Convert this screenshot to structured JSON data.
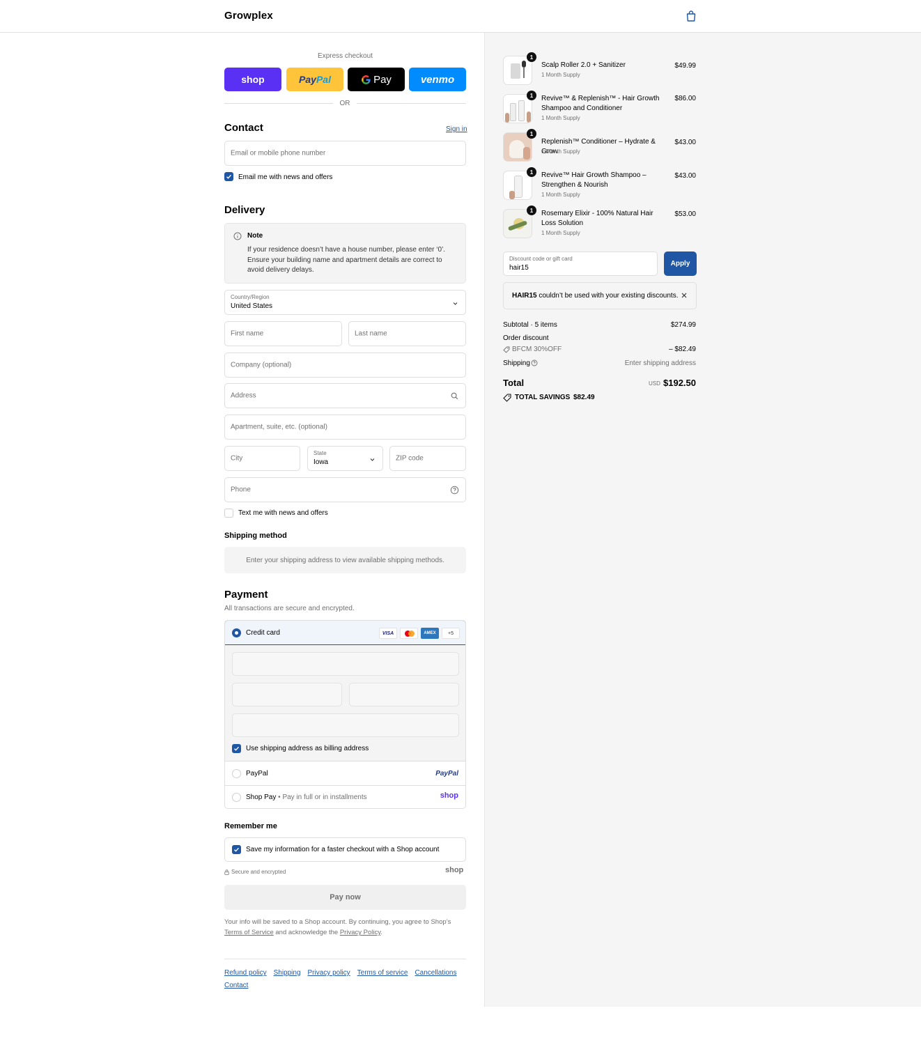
{
  "header": {
    "brand": "Growplex",
    "cart_icon": "shopping-bag-icon"
  },
  "express": {
    "title": "Express checkout",
    "buttons": [
      {
        "name": "shop",
        "label": "shop",
        "color": "#5a31f4"
      },
      {
        "name": "paypal",
        "label_a": "Pay",
        "label_b": "Pal",
        "color": "#ffc439"
      },
      {
        "name": "gpay",
        "label": "Pay",
        "color": "#000000"
      },
      {
        "name": "venmo",
        "label": "venmo",
        "color": "#008cff"
      }
    ],
    "or": "OR"
  },
  "contact": {
    "title": "Contact",
    "sign_in": "Sign in",
    "email_placeholder": "Email or mobile phone number",
    "email_news": "Email me with news and offers"
  },
  "delivery": {
    "title": "Delivery",
    "note_title": "Note",
    "note_text": "If your residence doesn’t have a house number, please enter ‘0’. Ensure your building name and apartment details are correct to avoid delivery delays.",
    "country_label": "Country/Region",
    "country_value": "United States",
    "first_name": "First name",
    "last_name": "Last name",
    "company": "Company (optional)",
    "address": "Address",
    "apartment": "Apartment, suite, etc. (optional)",
    "city": "City",
    "state_label": "State",
    "state_value": "Iowa",
    "zip": "ZIP code",
    "phone": "Phone",
    "text_news": "Text me with news and offers"
  },
  "shipping_method": {
    "title": "Shipping method",
    "placeholder": "Enter your shipping address to view available shipping methods."
  },
  "payment": {
    "title": "Payment",
    "subtitle": "All transactions are secure and encrypted.",
    "credit_card": "Credit card",
    "card_brands": [
      "VISA",
      "AMEX"
    ],
    "more_cards": "+5",
    "billing_same": "Use shipping address as billing address",
    "paypal": "PayPal",
    "paypal_logo": "PayPal",
    "shop_pay": "Shop Pay",
    "shop_pay_sub": "Pay in full or in installments",
    "shop_logo": "shop"
  },
  "remember": {
    "title": "Remember me",
    "save_info": "Save my information for a faster checkout with a Shop account",
    "secure": "Secure and encrypted",
    "shop_logo": "shop"
  },
  "pay_now": "Pay now",
  "legal": {
    "text_a": "Your info will be saved to a Shop account. By continuing, you agree to Shop’s",
    "tos": "Terms of Service",
    "text_b": "and acknowledge the",
    "privacy": "Privacy Policy",
    "text_c": "."
  },
  "footer_links": [
    "Refund policy",
    "Shipping",
    "Privacy policy",
    "Terms of service",
    "Cancellations",
    "Contact"
  ],
  "order": {
    "items": [
      {
        "qty": "1",
        "name": "Scalp Roller 2.0 + Sanitizer",
        "sub": "1 Month Supply",
        "price": "$49.99"
      },
      {
        "qty": "1",
        "name": "Revive™ & Replenish™ - Hair Growth Shampoo and Conditioner",
        "sub": "1 Month Supply",
        "price": "$86.00"
      },
      {
        "qty": "1",
        "name": "Replenish™ Conditioner – Hydrate & Grow",
        "sub": "1 Month Supply",
        "price": "$43.00"
      },
      {
        "qty": "1",
        "name": "Revive™ Hair Growth Shampoo – Strengthen & Nourish",
        "sub": "1 Month Supply",
        "price": "$43.00"
      },
      {
        "qty": "1",
        "name": "Rosemary Elixir - 100% Natural Hair Loss Solution",
        "sub": "1 Month Supply",
        "price": "$53.00"
      }
    ],
    "discount_label": "Discount code or gift card",
    "discount_value": "hair15",
    "apply": "Apply",
    "error_code": "HAIR15",
    "error_text": "couldn’t be used with your existing discounts.",
    "subtotal_label": "Subtotal · 5 items",
    "subtotal_value": "$274.99",
    "order_discount": "Order discount",
    "discount_code": "BFCM 30%OFF",
    "discount_amount": "– $82.49",
    "shipping_label": "Shipping",
    "shipping_value": "Enter shipping address",
    "total_label": "Total",
    "currency": "USD",
    "total_value": "$192.50",
    "savings_label": "TOTAL SAVINGS",
    "savings_value": "$82.49"
  },
  "colors": {
    "accent": "#1f57a4",
    "apply_bg": "#1f57a4"
  }
}
